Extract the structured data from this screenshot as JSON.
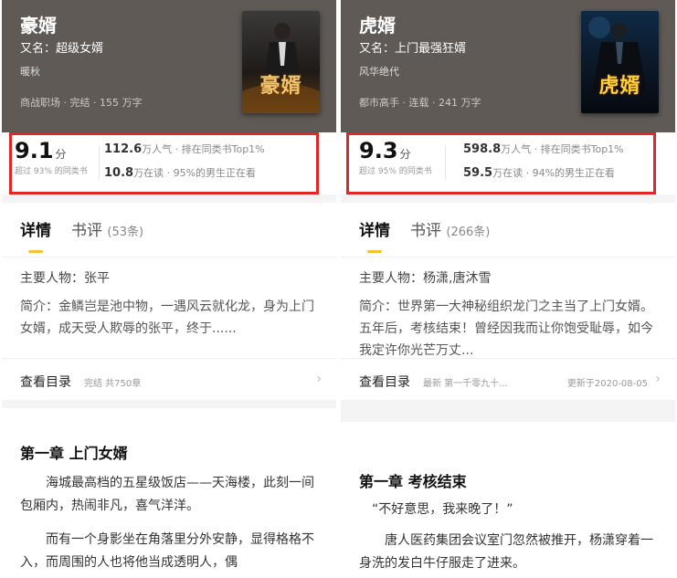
{
  "screens": [
    {
      "book": {
        "title": "豪婿",
        "alias": "又名：超级女婿",
        "author": "暖秋",
        "meta": "商战职场 · 完结 · 155 万字",
        "cover_text": "豪婿"
      },
      "rating": {
        "score": "9.1",
        "unit": "分",
        "sub": "超过 93% 的同类书",
        "stat1_num": "112.6",
        "stat1_text": "万人气 · 排在同类书Top1%",
        "stat2_num": "10.8",
        "stat2_text": "万在读 · 95%的男生正在看"
      },
      "tabs": {
        "detail": "详情",
        "review": "书评",
        "review_count": "(53条)"
      },
      "characters": "主要人物：张平",
      "intro": "简介：金鳞岂是池中物，一遇风云就化龙，身为上门女婿，成天受人欺辱的张平，终于......",
      "toc": {
        "label": "查看目录",
        "info": "完结 共750章",
        "update": ""
      },
      "chapter": {
        "title": "第一章 上门女婿",
        "paragraphs": [
          "海城最高档的五星级饭店——天海楼，此刻一间包厢内，热闹非凡，喜气洋洋。",
          "而有一个身影坐在角落里分外安静，显得格格不入，而周围的人也将他当成透明人，偶"
        ]
      }
    },
    {
      "book": {
        "title": "虎婿",
        "alias": "又名：上门最强狂婿",
        "author": "风华绝代",
        "meta": "都市高手 · 连载 · 241 万字",
        "cover_text": "虎婿"
      },
      "rating": {
        "score": "9.3",
        "unit": "分",
        "sub": "超过 95% 的同类书",
        "stat1_num": "598.8",
        "stat1_text": "万人气 · 排在同类书Top1%",
        "stat2_num": "59.5",
        "stat2_text": "万在读 · 94%的男生正在看"
      },
      "tabs": {
        "detail": "详情",
        "review": "书评",
        "review_count": "(266条)"
      },
      "characters": "主要人物：杨潇,唐沐雪",
      "intro": "简介：世界第一大神秘组织龙门之主当了上门女婿。五年后，考核结束！曾经因我而让你饱受耻辱，如今我定许你光芒万丈...",
      "toc": {
        "label": "查看目录",
        "info": "最新 第一千零九十...",
        "update": "更新于2020-08-05"
      },
      "chapter": {
        "title": "第一章 考核结束",
        "paragraphs": [
          "“不好意思，我来晚了！”",
          "唐人医药集团会议室门忽然被推开，杨潇穿着一身洗的发白牛仔服走了进来。"
        ]
      }
    }
  ],
  "colors": {
    "header_bg": "#5f5a56",
    "highlight_box": "#e12626",
    "tab_indicator": "#f2c230"
  }
}
